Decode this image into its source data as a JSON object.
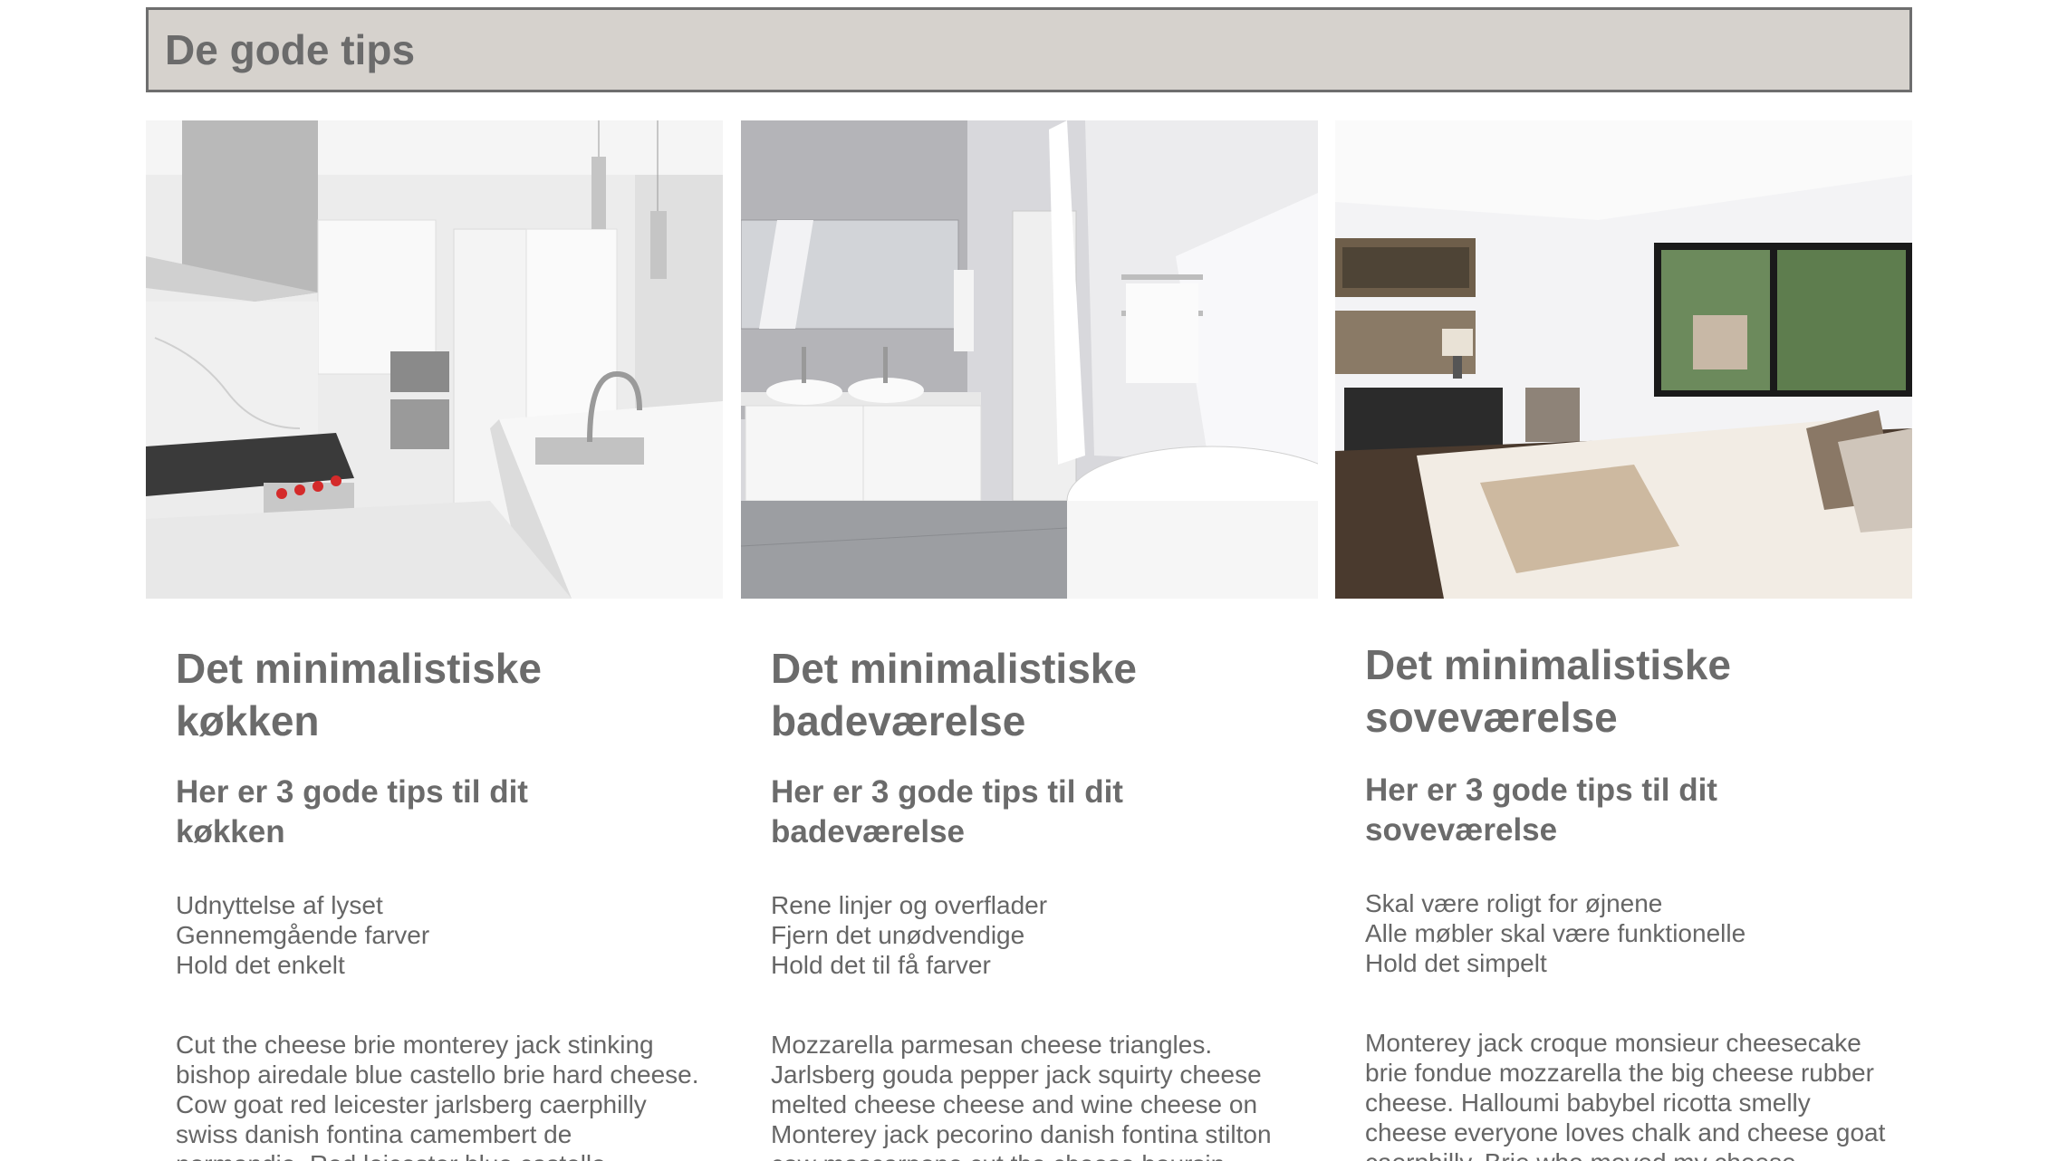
{
  "header": {
    "title": "De gode tips"
  },
  "cards": [
    {
      "image_alt": "kitchen-photo",
      "title": "Det minimalistiske køkken",
      "subtitle": "Her er 3 gode tips til dit køkken",
      "tips": [
        "Udnyttelse af lyset",
        "Gennemgående farver",
        "Hold det enkelt"
      ],
      "body": "Cut the cheese brie monterey jack stinking bishop airedale blue castello brie hard cheese. Cow goat red leicester jarlsberg caerphilly swiss danish fontina camembert de normandie. Red leicester blue castello"
    },
    {
      "image_alt": "bathroom-photo",
      "title": "Det minimalistiske badeværelse",
      "subtitle": "Her er 3 gode tips til dit badeværelse",
      "tips": [
        "Rene linjer og overflader",
        "Fjern det unødvendige",
        "Hold det til få farver"
      ],
      "body": "Mozzarella parmesan cheese triangles. Jarlsberg gouda pepper jack squirty cheese melted cheese cheese and wine cheese on Monterey jack pecorino danish fontina stilton cow mascarpone cut the cheese boursin."
    },
    {
      "image_alt": "bedroom-photo",
      "title": "Det minimalistiske soveværelse",
      "subtitle": "Her er 3 gode tips til dit soveværelse",
      "tips": [
        "Skal være roligt for øjnene",
        "Alle møbler skal være funktionelle",
        "Hold det simpelt"
      ],
      "body": "Monterey jack croque monsieur cheesecake brie fondue mozzarella the big cheese rubber cheese. Halloumi babybel ricotta smelly cheese everyone loves chalk and cheese goat caerphilly. Brie who moved my cheese."
    }
  ]
}
